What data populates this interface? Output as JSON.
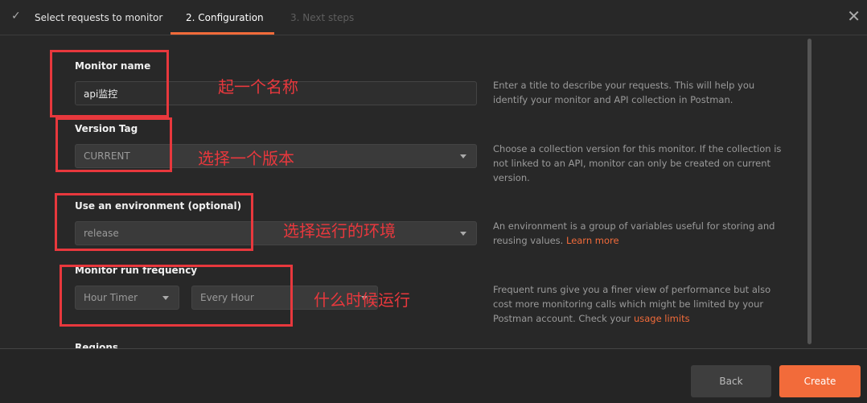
{
  "steps": [
    {
      "label": "Select requests to monitor",
      "done": true
    },
    {
      "label": "2. Configuration",
      "active": true
    },
    {
      "label": "3. Next steps"
    }
  ],
  "form": {
    "monitor_name": {
      "label": "Monitor name",
      "value": "api监控",
      "help": "Enter a title to describe your requests. This will help you identify your monitor and API collection in Postman."
    },
    "version_tag": {
      "label": "Version Tag",
      "value": "CURRENT",
      "help": "Choose a collection version for this monitor. If the collection is not linked to an API, monitor can only be created on current version."
    },
    "environment": {
      "label": "Use an environment (optional)",
      "value": "release",
      "help": "An environment is a group of variables useful for storing and reusing values.",
      "help_link": "Learn more"
    },
    "frequency": {
      "label": "Monitor run frequency",
      "timer": "Hour Timer",
      "interval": "Every Hour",
      "help": "Frequent runs give you a finer view of performance but also cost more monitoring calls which might be limited by your Postman account. Check your",
      "help_link": "usage limits"
    },
    "next_label_partial": "Regions"
  },
  "annotations": [
    "起一个名称",
    "选择一个版本",
    "选择运行的环境",
    "什么时候运行"
  ],
  "footer": {
    "back": "Back",
    "create": "Create"
  },
  "colors": {
    "accent": "#f26b3a",
    "annotation": "#e8383d"
  }
}
